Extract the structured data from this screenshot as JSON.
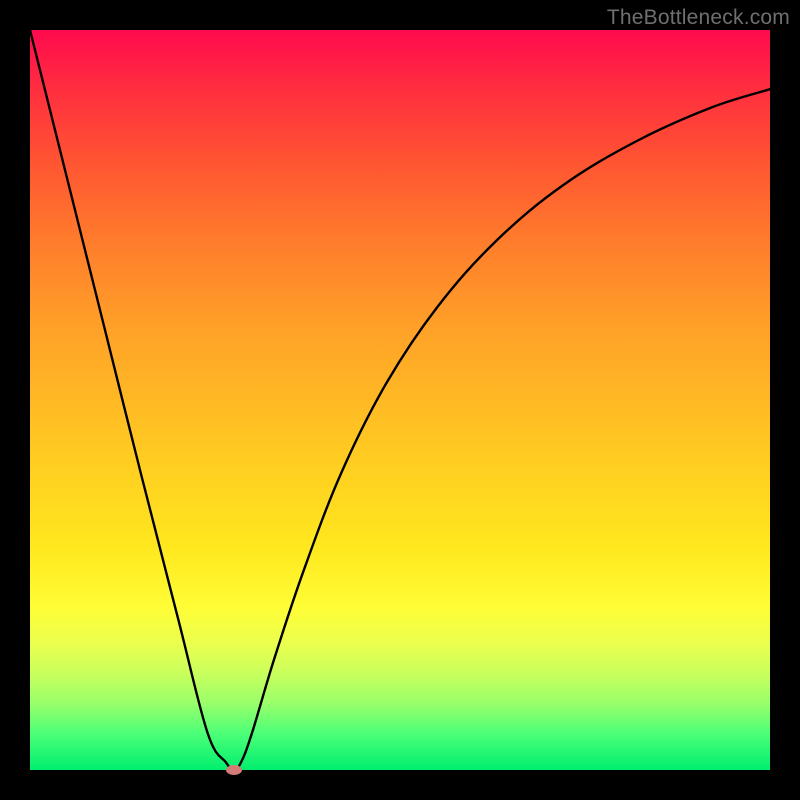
{
  "watermark": "TheBottleneck.com",
  "colors": {
    "frame_bg_top": "#ff0a4d",
    "frame_bg_bottom": "#00ef6e",
    "curve": "#000000",
    "dot": "#d57b77",
    "page_bg": "#000000",
    "watermark_text": "#6f6f6f"
  },
  "chart_data": {
    "type": "line",
    "title": "",
    "xlabel": "",
    "ylabel": "",
    "xlim": [
      0,
      100
    ],
    "ylim": [
      0,
      100
    ],
    "annotations": [
      {
        "text": "TheBottleneck.com",
        "pos": "top-right"
      }
    ],
    "series": [
      {
        "name": "bottleneck-curve",
        "x": [
          0,
          5,
          10,
          15,
          20,
          24,
          26.5,
          27.5,
          28.5,
          30,
          33,
          37,
          42,
          48,
          55,
          63,
          72,
          82,
          92,
          100
        ],
        "values": [
          100,
          80,
          60,
          40,
          20.5,
          5,
          1,
          0,
          1,
          5,
          15,
          27,
          40,
          52,
          62.5,
          71.5,
          79,
          85,
          89.5,
          92
        ]
      }
    ],
    "markers": [
      {
        "name": "minimum-point",
        "x": 27.5,
        "y": 0
      }
    ]
  }
}
